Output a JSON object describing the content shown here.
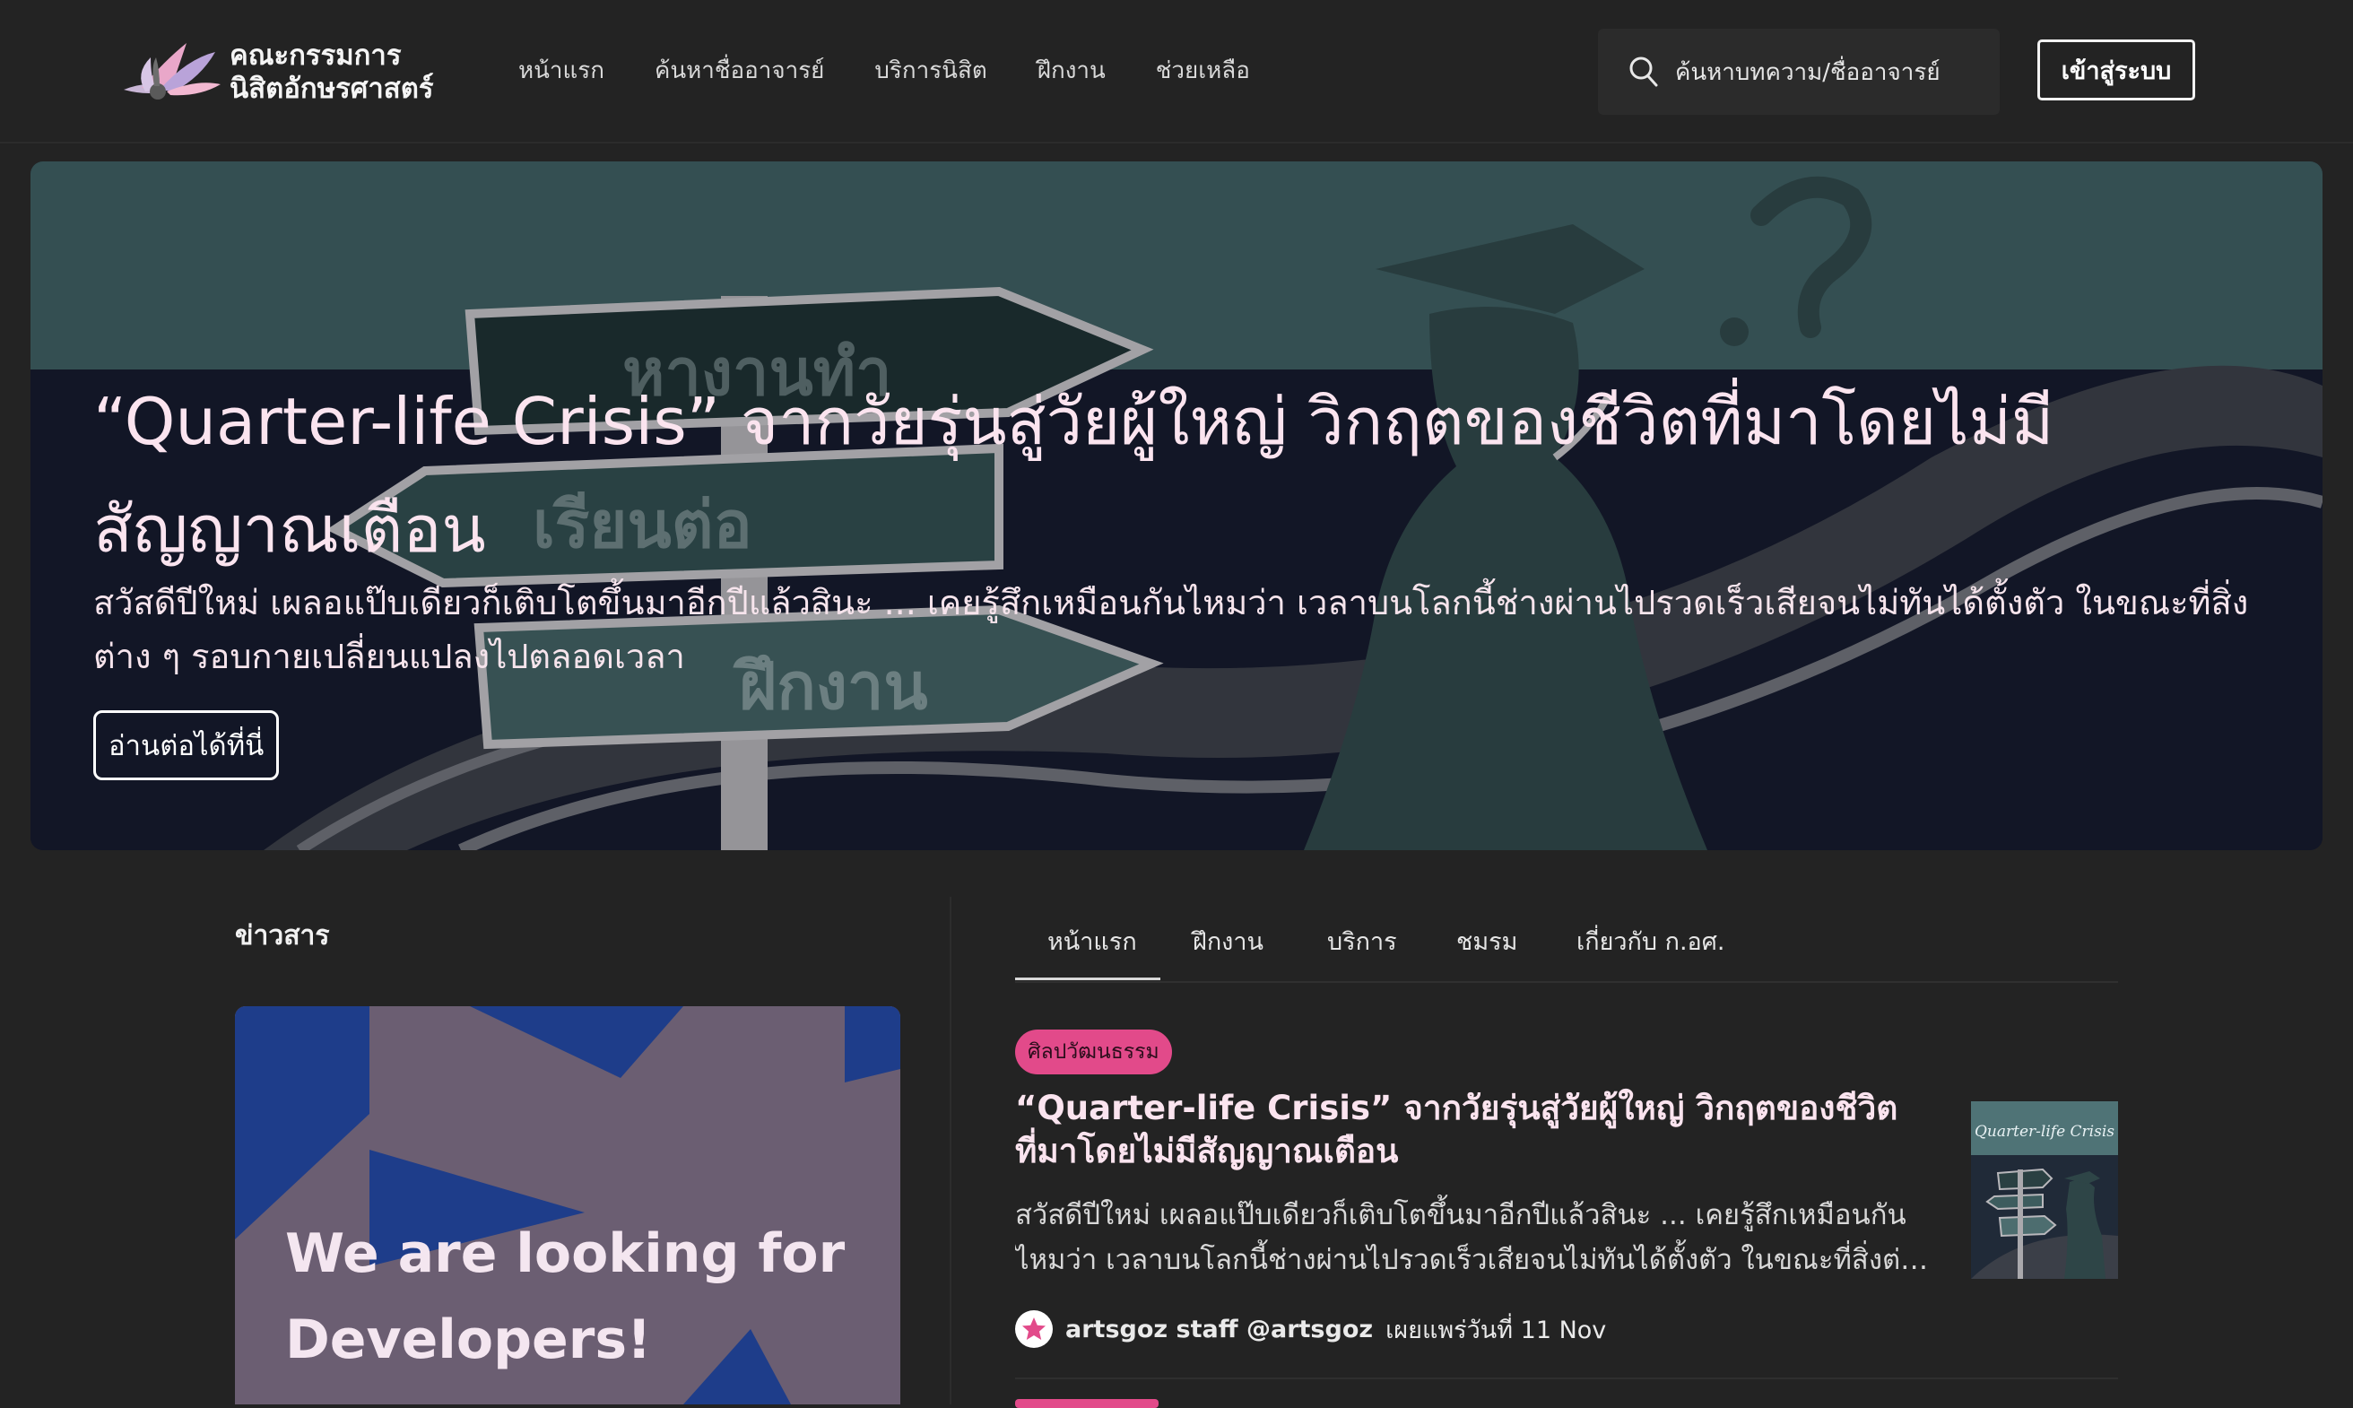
{
  "header": {
    "logo_line1": "คณะกรรมการ",
    "logo_line2": "นิสิตอักษรศาสตร์",
    "nav": [
      "หน้าแรก",
      "ค้นหาชื่ออาจารย์",
      "บริการนิสิต",
      "ฝึกงาน",
      "ช่วยเหลือ"
    ],
    "search_placeholder": "ค้นหาบทความ/ชื่ออาจารย์",
    "login_label": "เข้าสู่ระบบ"
  },
  "hero": {
    "title": "“Quarter-life Crisis” จากวัยรุ่นสู่วัยผู้ใหญ่ วิกฤตของชีวิตที่มาโดยไม่มีสัญญาณเตือน",
    "description": "สวัสดีปีใหม่ เผลอแป๊บเดียวก็เติบโตขึ้นมาอีกปีแล้วสินะ ... เคยรู้สึกเหมือนกันไหมว่า เวลาบนโลกนี้ช่างผ่านไปรวดเร็วเสียจนไม่ทันได้ตั้งตัว ในขณะที่สิ่งต่าง ๆ รอบกายเปลี่ยนแปลงไปตลอดเวลา",
    "read_more": "อ่านต่อได้ที่นี่",
    "signs": [
      "หางานทำ",
      "เรียนต่อ",
      "ฝึกงาน"
    ]
  },
  "news": {
    "heading": "ข่าวสาร",
    "promo_line1": "We are looking for",
    "promo_line2": "Developers!"
  },
  "tabs": [
    "หน้าแรก",
    "ฝึกงาน",
    "บริการ",
    "ชมรม",
    "เกี่ยวกับ ก.อศ."
  ],
  "active_tab": "หน้าแรก",
  "article": {
    "category": "ศิลปวัฒนธรรม",
    "title": "“Quarter-life Crisis” จากวัยรุ่นสู่วัยผู้ใหญ่ วิกฤตของชีวิตที่มาโดยไม่มีสัญญาณเตือน",
    "excerpt": "สวัสดีปีใหม่ เผลอแป๊บเดียวก็เติบโตขึ้นมาอีกปีแล้วสินะ ... เคยรู้สึกเหมือนกันไหมว่า เวลาบนโลกนี้ช่างผ่านไปรวดเร็วเสียจนไม่ทันได้ตั้งตัว ในขณะที่สิ่งต่าง ...",
    "thumb_title": "Quarter-life Crisis",
    "author": "artsgoz staff @artsgoz",
    "date": "เผยแพร่วันที่ 11 Nov"
  },
  "colors": {
    "background": "#232323",
    "accent_pink": "#e24a8a",
    "hero_text": "#fbe4ef"
  }
}
